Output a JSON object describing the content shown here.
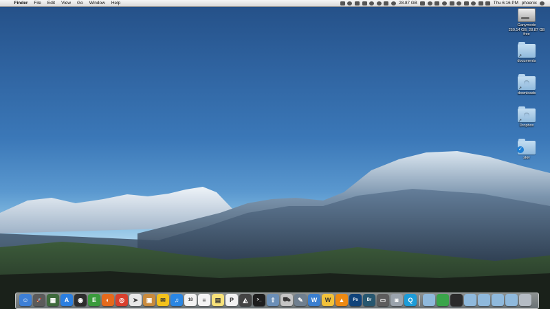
{
  "menubar": {
    "apple": "",
    "menus": [
      "Finder",
      "File",
      "Edit",
      "View",
      "Go",
      "Window",
      "Help"
    ],
    "status": {
      "storage": "28.87 GB",
      "clock": "Thu 6:16 PM",
      "user": "phoenix"
    }
  },
  "desktop_icons": [
    {
      "label": "Ganymede\n250.14 GB, 28.87 GB free",
      "icon": "hard-drive-icon"
    },
    {
      "label": "documents",
      "icon": "folder-icon"
    },
    {
      "label": "downloads",
      "icon": "downloads-folder-icon"
    },
    {
      "label": "Dropbox",
      "icon": "dropbox-folder-icon"
    },
    {
      "label": "skiv",
      "icon": "synced-folder-icon"
    }
  ],
  "dock": {
    "items": [
      {
        "name": "finder",
        "color": "#3d7fd6",
        "glyph": "☺"
      },
      {
        "name": "launchpad",
        "color": "#5b5b5b",
        "glyph": "🚀"
      },
      {
        "name": "mission-control",
        "color": "#3f6b3d",
        "glyph": "▦"
      },
      {
        "name": "app-store",
        "color": "#2b7fe0",
        "glyph": "A"
      },
      {
        "name": "dashboard",
        "color": "#2d2d2d",
        "glyph": "◉"
      },
      {
        "name": "evernote",
        "color": "#3a9b3c",
        "glyph": "E"
      },
      {
        "name": "firefox",
        "color": "#e56a1c",
        "glyph": "◐"
      },
      {
        "name": "chrome",
        "color": "#d9402e",
        "glyph": "◎"
      },
      {
        "name": "mail-send",
        "color": "#e8e8e8",
        "glyph": "➤"
      },
      {
        "name": "package",
        "color": "#c98b3d",
        "glyph": "▣"
      },
      {
        "name": "sparrow-mail",
        "color": "#f3c21b",
        "glyph": "✉"
      },
      {
        "name": "itunes",
        "color": "#2a86e2",
        "glyph": "♫"
      },
      {
        "name": "calendar",
        "color": "#f2f2f2",
        "glyph": "18"
      },
      {
        "name": "text-edit",
        "color": "#f4f4f4",
        "glyph": "≡"
      },
      {
        "name": "stickies",
        "color": "#f7e27a",
        "glyph": "▤"
      },
      {
        "name": "pandora",
        "color": "#f2f2f2",
        "glyph": "P"
      },
      {
        "name": "alfred",
        "color": "#444444",
        "glyph": "◭"
      },
      {
        "name": "terminal",
        "color": "#1d1d1d",
        "glyph": ">_"
      },
      {
        "name": "uploader",
        "color": "#6b8fb7",
        "glyph": "⇧"
      },
      {
        "name": "transmit",
        "color": "#c5c5c5",
        "glyph": "⛟"
      },
      {
        "name": "preview",
        "color": "#6f7f8f",
        "glyph": "✎"
      },
      {
        "name": "wunderlist",
        "color": "#3a7fd0",
        "glyph": "W"
      },
      {
        "name": "word",
        "color": "#f2c23a",
        "glyph": "W"
      },
      {
        "name": "vlc",
        "color": "#ee8a12",
        "glyph": "▲"
      },
      {
        "name": "photoshop",
        "color": "#10437a",
        "glyph": "Ps"
      },
      {
        "name": "bridge",
        "color": "#27576f",
        "glyph": "Br"
      },
      {
        "name": "screen-capture",
        "color": "#5d5d5d",
        "glyph": "▭"
      },
      {
        "name": "image-capture",
        "color": "#9aa3ac",
        "glyph": "◙"
      },
      {
        "name": "quicktime",
        "color": "#1c9cd8",
        "glyph": "Q"
      }
    ],
    "stacks": [
      {
        "name": "applications-folder",
        "color": "#8fb9dc"
      },
      {
        "name": "activity-monitor",
        "color": "#3aa54a"
      },
      {
        "name": "system-monitor",
        "color": "#2b2b2b"
      },
      {
        "name": "documents-stack",
        "color": "#8fb9dc"
      },
      {
        "name": "downloads-stack",
        "color": "#8fb9dc"
      },
      {
        "name": "folder-stack",
        "color": "#8fb9dc"
      },
      {
        "name": "folder-stack-2",
        "color": "#8fb9dc"
      },
      {
        "name": "trash",
        "color": "#b5bcc4"
      }
    ]
  }
}
